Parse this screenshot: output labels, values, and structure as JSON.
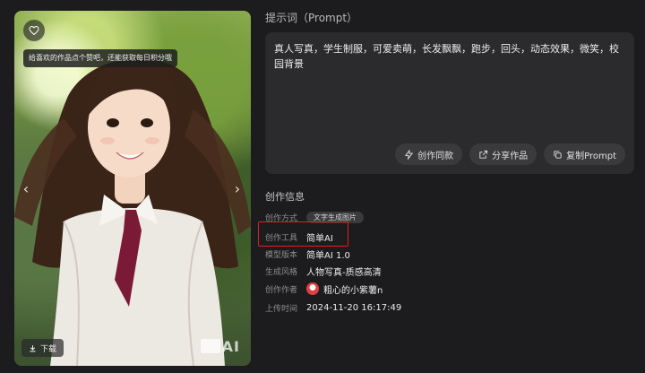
{
  "image": {
    "tooltip": "给喜欢的作品点个赞吧，还能获取每日积分哦",
    "download_label": "下载",
    "watermark": "AI",
    "icons": {
      "like": "heart-icon",
      "prev": "chevron-left-icon",
      "next": "chevron-right-icon",
      "download": "download-icon"
    }
  },
  "prompt": {
    "heading": "提示词（Prompt）",
    "text": "真人写真，学生制服，可爱卖萌，长发飘飘，跑步，回头，动态效果，微笑，校园背景",
    "actions": [
      {
        "label": "创作同款",
        "icon": "lightning-icon"
      },
      {
        "label": "分享作品",
        "icon": "share-icon"
      },
      {
        "label": "复制Prompt",
        "icon": "copy-icon"
      }
    ]
  },
  "info": {
    "heading": "创作信息",
    "rows": [
      {
        "key": "创作方式",
        "value": "文字生成图片"
      },
      {
        "key": "创作工具",
        "value": "简单AI"
      },
      {
        "key": "模型版本",
        "value": "简单AI 1.0"
      },
      {
        "key": "生成风格",
        "value": "人物写真-质感高清"
      },
      {
        "key": "创作作者",
        "value": "粗心的小紫薯n"
      },
      {
        "key": "上传时间",
        "value": "2024-11-20 16:17:49"
      }
    ]
  },
  "colors": {
    "background": "#1c1c1e",
    "panel": "#2b2b2d",
    "button": "#3a3a3d",
    "highlight": "#e02020"
  }
}
